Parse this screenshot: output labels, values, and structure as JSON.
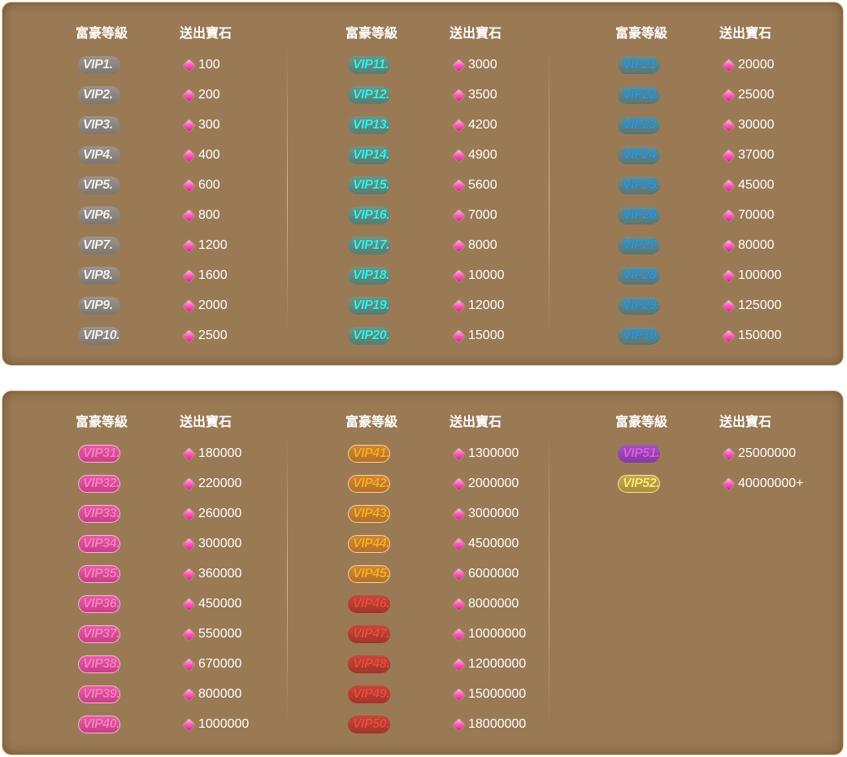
{
  "headers": {
    "level": "富豪等級",
    "gems": "送出寶石"
  },
  "colors": {
    "panel_bg": "#9a7a55",
    "panel_border": "#e9c9a8",
    "text": "#ffffff",
    "gem": "#ff5fb9"
  },
  "icons": {
    "gem": "gem-icon"
  },
  "panels": [
    {
      "columns": [
        {
          "rows": [
            {
              "level": "VIP1.",
              "gems": "100",
              "tier": "silver"
            },
            {
              "level": "VIP2.",
              "gems": "200",
              "tier": "silver"
            },
            {
              "level": "VIP3.",
              "gems": "300",
              "tier": "silver"
            },
            {
              "level": "VIP4.",
              "gems": "400",
              "tier": "silver"
            },
            {
              "level": "VIP5.",
              "gems": "600",
              "tier": "silver"
            },
            {
              "level": "VIP6.",
              "gems": "800",
              "tier": "silver"
            },
            {
              "level": "VIP7.",
              "gems": "1200",
              "tier": "silver"
            },
            {
              "level": "VIP8.",
              "gems": "1600",
              "tier": "silver"
            },
            {
              "level": "VIP9.",
              "gems": "2000",
              "tier": "silver"
            },
            {
              "level": "VIP10.",
              "gems": "2500",
              "tier": "silver"
            }
          ]
        },
        {
          "rows": [
            {
              "level": "VIP11.",
              "gems": "3000",
              "tier": "teal"
            },
            {
              "level": "VIP12.",
              "gems": "3500",
              "tier": "teal"
            },
            {
              "level": "VIP13.",
              "gems": "4200",
              "tier": "teal"
            },
            {
              "level": "VIP14.",
              "gems": "4900",
              "tier": "teal"
            },
            {
              "level": "VIP15.",
              "gems": "5600",
              "tier": "teal"
            },
            {
              "level": "VIP16.",
              "gems": "7000",
              "tier": "teal"
            },
            {
              "level": "VIP17.",
              "gems": "8000",
              "tier": "teal"
            },
            {
              "level": "VIP18.",
              "gems": "10000",
              "tier": "teal"
            },
            {
              "level": "VIP19.",
              "gems": "12000",
              "tier": "teal"
            },
            {
              "level": "VIP20.",
              "gems": "15000",
              "tier": "teal"
            }
          ]
        },
        {
          "rows": [
            {
              "level": "VIP21.",
              "gems": "20000",
              "tier": "blue"
            },
            {
              "level": "VIP22.",
              "gems": "25000",
              "tier": "blue"
            },
            {
              "level": "VIP23.",
              "gems": "30000",
              "tier": "blue"
            },
            {
              "level": "VIP24.",
              "gems": "37000",
              "tier": "blue"
            },
            {
              "level": "VIP25.",
              "gems": "45000",
              "tier": "blue"
            },
            {
              "level": "VIP26.",
              "gems": "70000",
              "tier": "blue"
            },
            {
              "level": "VIP27.",
              "gems": "80000",
              "tier": "blue"
            },
            {
              "level": "VIP28.",
              "gems": "100000",
              "tier": "blue"
            },
            {
              "level": "VIP29.",
              "gems": "125000",
              "tier": "blue"
            },
            {
              "level": "VIP30.",
              "gems": "150000",
              "tier": "blue"
            }
          ]
        }
      ]
    },
    {
      "columns": [
        {
          "rows": [
            {
              "level": "VIP31.",
              "gems": "180000",
              "tier": "pink"
            },
            {
              "level": "VIP32.",
              "gems": "220000",
              "tier": "pink"
            },
            {
              "level": "VIP33.",
              "gems": "260000",
              "tier": "pink"
            },
            {
              "level": "VIP34.",
              "gems": "300000",
              "tier": "pink"
            },
            {
              "level": "VIP35.",
              "gems": "360000",
              "tier": "pink"
            },
            {
              "level": "VIP36.",
              "gems": "450000",
              "tier": "pink"
            },
            {
              "level": "VIP37.",
              "gems": "550000",
              "tier": "pink"
            },
            {
              "level": "VIP38.",
              "gems": "670000",
              "tier": "pink"
            },
            {
              "level": "VIP39.",
              "gems": "800000",
              "tier": "pink"
            },
            {
              "level": "VIP40.",
              "gems": "1000000",
              "tier": "pink"
            }
          ]
        },
        {
          "rows": [
            {
              "level": "VIP41.",
              "gems": "1300000",
              "tier": "orange"
            },
            {
              "level": "VIP42.",
              "gems": "2000000",
              "tier": "orange"
            },
            {
              "level": "VIP43.",
              "gems": "3000000",
              "tier": "orange"
            },
            {
              "level": "VIP44.",
              "gems": "4500000",
              "tier": "orange"
            },
            {
              "level": "VIP45.",
              "gems": "6000000",
              "tier": "orange"
            },
            {
              "level": "VIP46.",
              "gems": "8000000",
              "tier": "red"
            },
            {
              "level": "VIP47.",
              "gems": "10000000",
              "tier": "red"
            },
            {
              "level": "VIP48.",
              "gems": "12000000",
              "tier": "red"
            },
            {
              "level": "VIP49.",
              "gems": "15000000",
              "tier": "red"
            },
            {
              "level": "VIP50.",
              "gems": "18000000",
              "tier": "red"
            }
          ]
        },
        {
          "rows": [
            {
              "level": "VIP51.",
              "gems": "25000000",
              "tier": "purple"
            },
            {
              "level": "VIP52.",
              "gems": "40000000+",
              "tier": "gold"
            }
          ]
        }
      ]
    }
  ]
}
